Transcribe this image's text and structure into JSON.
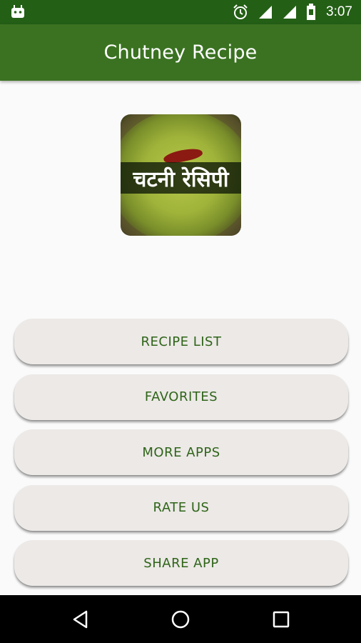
{
  "status_bar": {
    "time": "3:07",
    "icons": [
      "android-icon",
      "alarm-icon",
      "signal-icon",
      "signal-icon",
      "battery-icon"
    ]
  },
  "app_bar": {
    "title": "Chutney Recipe"
  },
  "logo": {
    "text": "चटनी रेसिपी"
  },
  "menu": {
    "items": [
      {
        "label": "RECIPE LIST"
      },
      {
        "label": "FAVORITES"
      },
      {
        "label": "MORE APPS"
      },
      {
        "label": "RATE US"
      },
      {
        "label": "SHARE APP"
      }
    ]
  },
  "nav_bar": {
    "icons": [
      "back-icon",
      "home-icon",
      "recents-icon"
    ]
  },
  "colors": {
    "status_bar": "#245f16",
    "app_bar": "#3a7221",
    "button_bg": "#ece9e7",
    "button_text": "#2f6418",
    "background": "#fafafa"
  }
}
